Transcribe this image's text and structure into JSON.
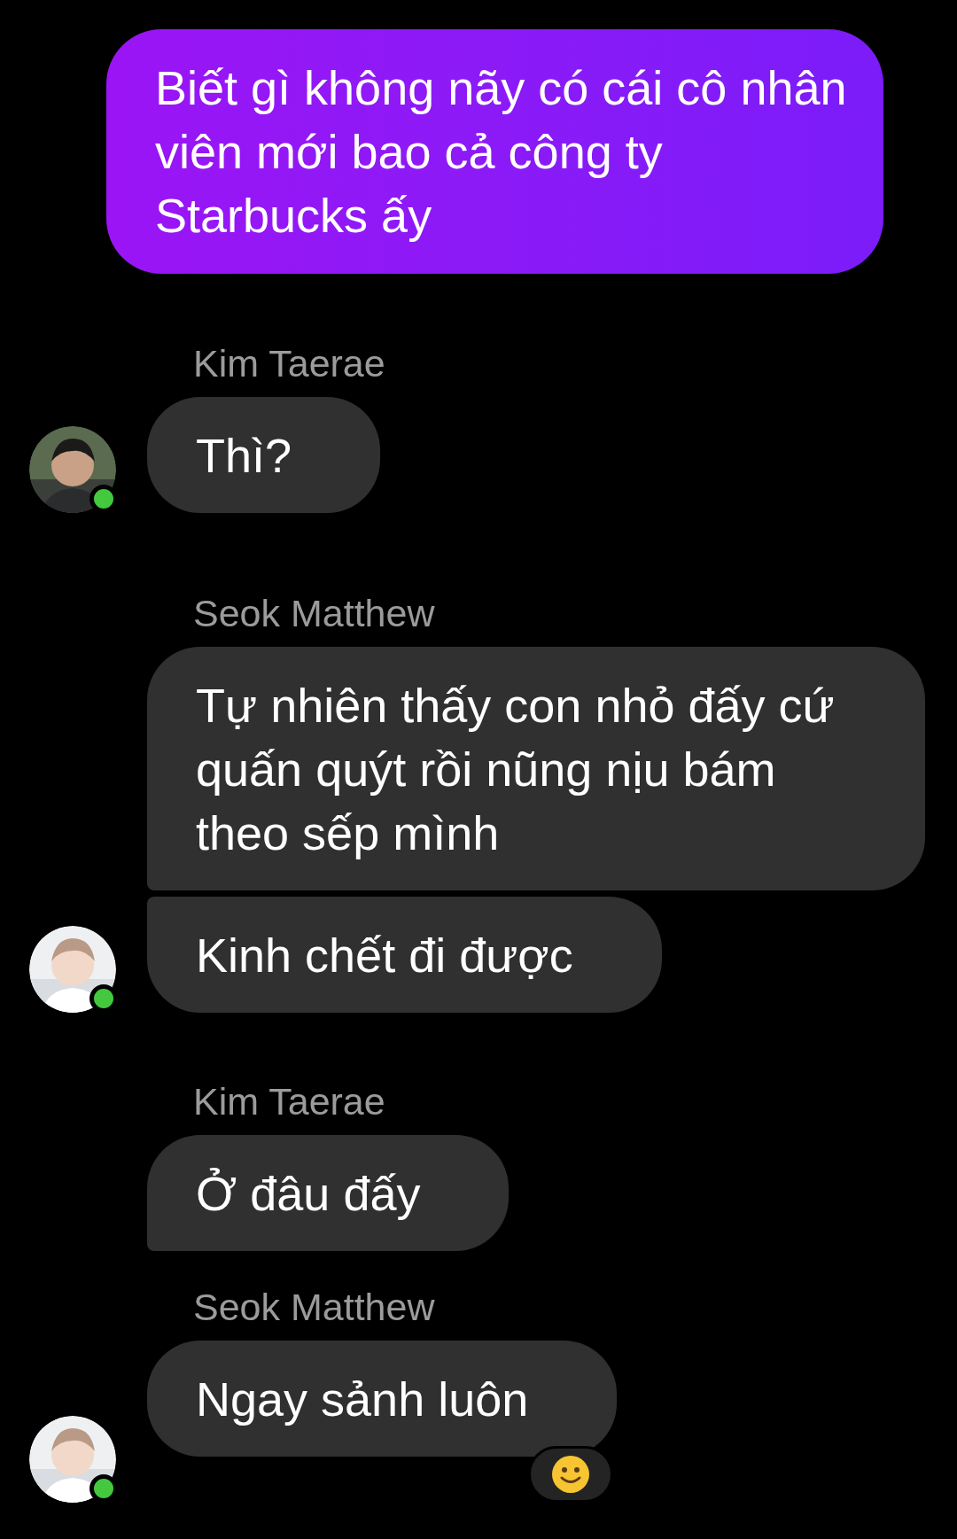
{
  "messages": [
    {
      "kind": "outgoing",
      "text": "Biết gì không nãy có cái cô nhân viên mới bao cả công ty Starbucks ấy"
    },
    {
      "kind": "incoming",
      "sender": "Kim Taerae",
      "avatar": {
        "online": true
      },
      "bubbles": [
        {
          "text": "Thì?",
          "joined_above": false,
          "joined_below": false
        }
      ]
    },
    {
      "kind": "incoming",
      "sender": "Seok Matthew",
      "avatar": {
        "online": true
      },
      "bubbles": [
        {
          "text": "Tự nhiên thấy con nhỏ đấy cứ quấn quýt rồi nũng nịu bám theo sếp mình",
          "joined_above": false,
          "joined_below": true
        },
        {
          "text": "Kinh chết đi được",
          "joined_above": true,
          "joined_below": false
        }
      ]
    },
    {
      "kind": "incoming",
      "sender": "Kim Taerae",
      "bubbles": [
        {
          "text": "Ở đâu đấy",
          "joined_above": false,
          "joined_below": true
        }
      ]
    },
    {
      "kind": "incoming",
      "sender": "Seok Matthew",
      "avatar": {
        "online": true
      },
      "bubbles": [
        {
          "text": "Ngay sảnh luôn",
          "joined_above": false,
          "joined_below": false,
          "reacted": true
        }
      ]
    }
  ]
}
